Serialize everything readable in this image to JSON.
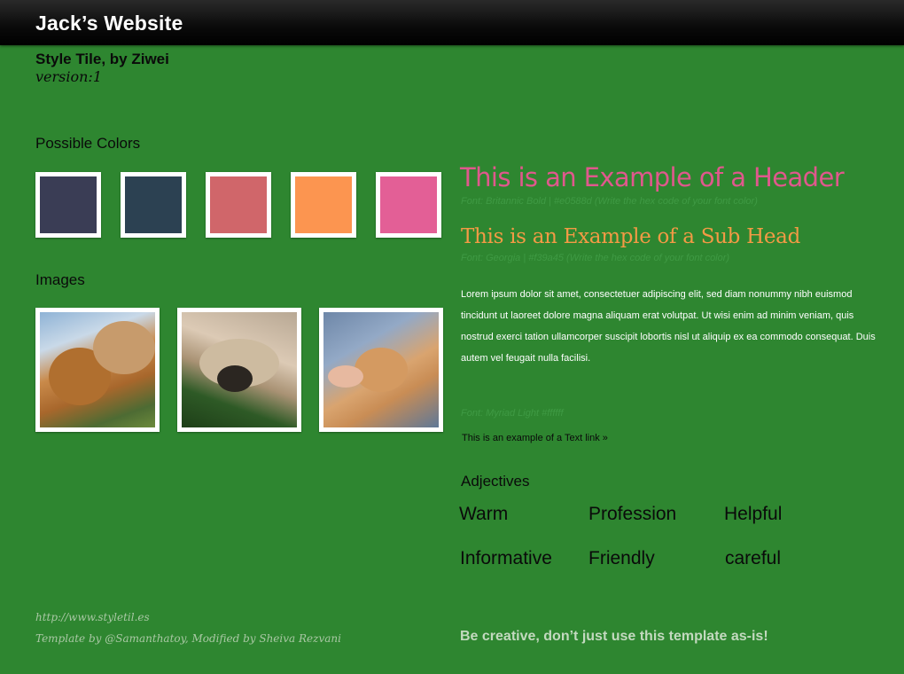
{
  "site": {
    "title": "Jack’s Website"
  },
  "tile": {
    "title": "Style Tile, by Ziwei",
    "version": "version:1"
  },
  "colors": {
    "heading": "Possible Colors",
    "swatches": [
      "#3a3d55",
      "#2c4152",
      "#d0666a",
      "#fc9550",
      "#e35f96"
    ]
  },
  "images": {
    "heading": "Images",
    "items": [
      "golden-retriever-photo",
      "sleeping-puppy-photo",
      "puppy-in-hands-photo"
    ]
  },
  "typography": {
    "header_example": "This is an Example of a Header",
    "header_note": "Font: Britannic Bold  |  #e0588d (Write the hex code of your font color)",
    "header_color": "#e0588d",
    "subhead_example": "This is an Example of a Sub Head",
    "subhead_note": "Font: Georgia  |  #f39a45 (Write the hex code of your font color)",
    "subhead_color": "#f39a45",
    "body_text": "Lorem ipsum dolor sit amet, consectetuer adipiscing elit, sed diam nonummy nibh euismod tincidunt ut laoreet dolore magna aliquam erat volutpat. Ut wisi enim ad minim veniam, quis nostrud exerci tation ullamcorper suscipit lobortis nisl ut aliquip ex ea commodo consequat. Duis autem vel feugait nulla facilisi.",
    "body_note": "Font: Myriad Light #ffffff",
    "link_text": "This is an example of a Text link »"
  },
  "adjectives": {
    "heading": "Adjectives",
    "items": [
      "Warm",
      "Profession",
      "Helpful",
      "Informative",
      "Friendly",
      "careful"
    ]
  },
  "footer": {
    "url": "http://www.styletil.es",
    "credit": "Template by @Samanthatoy, Modified by Sheiva Rezvani",
    "cta": "Be creative, don’t just use this template as-is!"
  }
}
